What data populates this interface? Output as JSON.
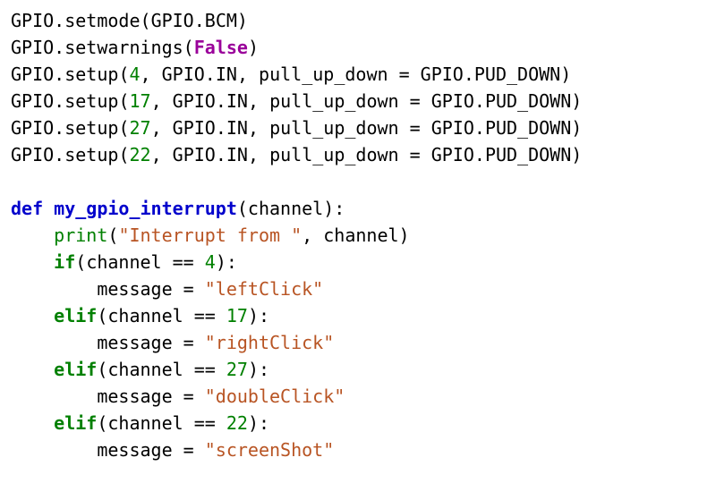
{
  "code": {
    "line1": {
      "a": "GPIO",
      "b": ".",
      "c": "setmode",
      "d": "(",
      "e": "GPIO",
      "f": ".",
      "g": "BCM",
      "h": ")"
    },
    "line2": {
      "a": "GPIO",
      "b": ".",
      "c": "setwarnings",
      "d": "(",
      "e": "False",
      "f": ")"
    },
    "line3": {
      "a": "GPIO",
      "b": ".",
      "c": "setup",
      "d": "(",
      "e": "4",
      "f": ", ",
      "g": "GPIO",
      "h": ".",
      "i": "IN",
      "j": ", ",
      "k": "pull_up_down ",
      "l": "=",
      "m": " GPIO",
      "n": ".",
      "o": "PUD_DOWN",
      "p": ")"
    },
    "line4": {
      "a": "GPIO",
      "b": ".",
      "c": "setup",
      "d": "(",
      "e": "17",
      "f": ", ",
      "g": "GPIO",
      "h": ".",
      "i": "IN",
      "j": ", ",
      "k": "pull_up_down ",
      "l": "=",
      "m": " GPIO",
      "n": ".",
      "o": "PUD_DOWN",
      "p": ")"
    },
    "line5": {
      "a": "GPIO",
      "b": ".",
      "c": "setup",
      "d": "(",
      "e": "27",
      "f": ", ",
      "g": "GPIO",
      "h": ".",
      "i": "IN",
      "j": ", ",
      "k": "pull_up_down ",
      "l": "=",
      "m": " GPIO",
      "n": ".",
      "o": "PUD_DOWN",
      "p": ")"
    },
    "line6": {
      "a": "GPIO",
      "b": ".",
      "c": "setup",
      "d": "(",
      "e": "22",
      "f": ", ",
      "g": "GPIO",
      "h": ".",
      "i": "IN",
      "j": ", ",
      "k": "pull_up_down ",
      "l": "=",
      "m": " GPIO",
      "n": ".",
      "o": "PUD_DOWN",
      "p": ")"
    },
    "line8": {
      "a": "def",
      "b": " ",
      "c": "my_gpio_interrupt",
      "d": "(",
      "e": "channel",
      "f": "):"
    },
    "line9": {
      "a": "    ",
      "b": "print",
      "c": "(",
      "d": "\"Interrupt from \"",
      "e": ", ",
      "f": "channel",
      "g": ")"
    },
    "line10": {
      "a": "    ",
      "b": "if",
      "c": "(",
      "d": "channel ",
      "e": "==",
      "f": " ",
      "g": "4",
      "h": "):"
    },
    "line11": {
      "a": "        ",
      "b": "message ",
      "c": "=",
      "d": " ",
      "e": "\"leftClick\""
    },
    "line12": {
      "a": "    ",
      "b": "elif",
      "c": "(",
      "d": "channel ",
      "e": "==",
      "f": " ",
      "g": "17",
      "h": "):"
    },
    "line13": {
      "a": "        ",
      "b": "message ",
      "c": "=",
      "d": " ",
      "e": "\"rightClick\""
    },
    "line14": {
      "a": "    ",
      "b": "elif",
      "c": "(",
      "d": "channel ",
      "e": "==",
      "f": " ",
      "g": "27",
      "h": "):"
    },
    "line15": {
      "a": "        ",
      "b": "message ",
      "c": "=",
      "d": " ",
      "e": "\"doubleClick\""
    },
    "line16": {
      "a": "    ",
      "b": "elif",
      "c": "(",
      "d": "channel ",
      "e": "==",
      "f": " ",
      "g": "22",
      "h": "):"
    },
    "line17": {
      "a": "        ",
      "b": "message ",
      "c": "=",
      "d": " ",
      "e": "\"screenShot\""
    }
  }
}
